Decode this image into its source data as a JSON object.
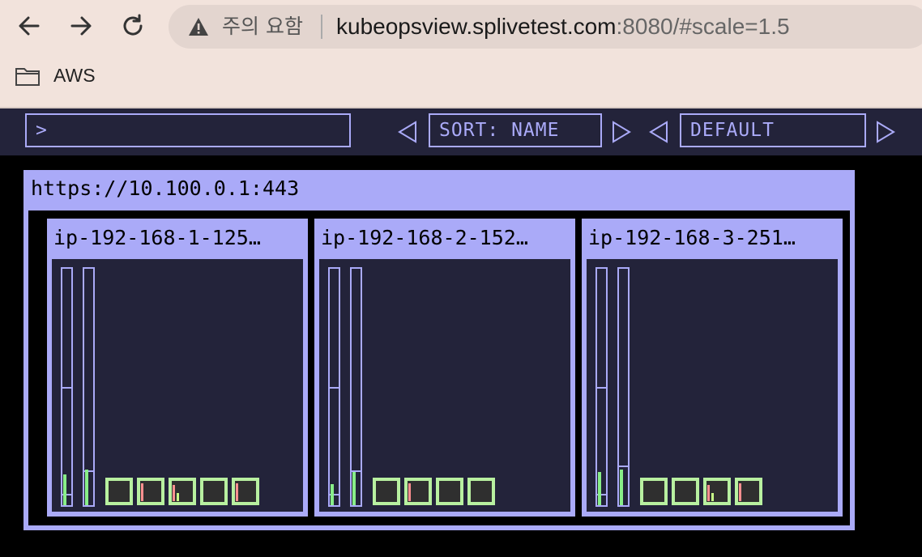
{
  "browser": {
    "security_label": "주의 요함",
    "url_host": "kubeopsview.splivetest.com",
    "url_rest": ":8080/#scale=1.5",
    "bookmark_label": "AWS"
  },
  "toolbar": {
    "filter_value": ">",
    "sort_label": "SORT: NAME",
    "theme_label": "DEFAULT"
  },
  "cluster": {
    "title": "https://10.100.0.1:443",
    "nodes": [
      {
        "name": "ip-192-168-1-125…",
        "cpu_usage": 0.13,
        "cpu_requests": 0.04,
        "mem_usage": 0.15,
        "mem_requests": 0.14,
        "pods": [
          {
            "cpu": 0.0,
            "mem": 0.0
          },
          {
            "cpu": 0.9,
            "mem": 0.0
          },
          {
            "cpu": 0.85,
            "mem": 0.4
          },
          {
            "cpu": 0.0,
            "mem": 0.0
          },
          {
            "cpu": 0.9,
            "mem": 0.0
          }
        ]
      },
      {
        "name": "ip-192-168-2-152…",
        "cpu_usage": 0.09,
        "cpu_requests": 0.04,
        "mem_usage": 0.14,
        "mem_requests": 0.14,
        "pods": [
          {
            "cpu": 0.0,
            "mem": 0.0
          },
          {
            "cpu": 0.9,
            "mem": 0.0
          },
          {
            "cpu": 0.0,
            "mem": 0.0
          },
          {
            "cpu": 0.0,
            "mem": 0.0
          }
        ]
      },
      {
        "name": "ip-192-168-3-251…",
        "cpu_usage": 0.14,
        "cpu_requests": 0.04,
        "mem_usage": 0.15,
        "mem_requests": 0.16,
        "pods": [
          {
            "cpu": 0.0,
            "mem": 0.0
          },
          {
            "cpu": 0.0,
            "mem": 0.0
          },
          {
            "cpu": 0.85,
            "mem": 0.4
          },
          {
            "cpu": 0.9,
            "mem": 0.0
          }
        ]
      }
    ]
  }
}
